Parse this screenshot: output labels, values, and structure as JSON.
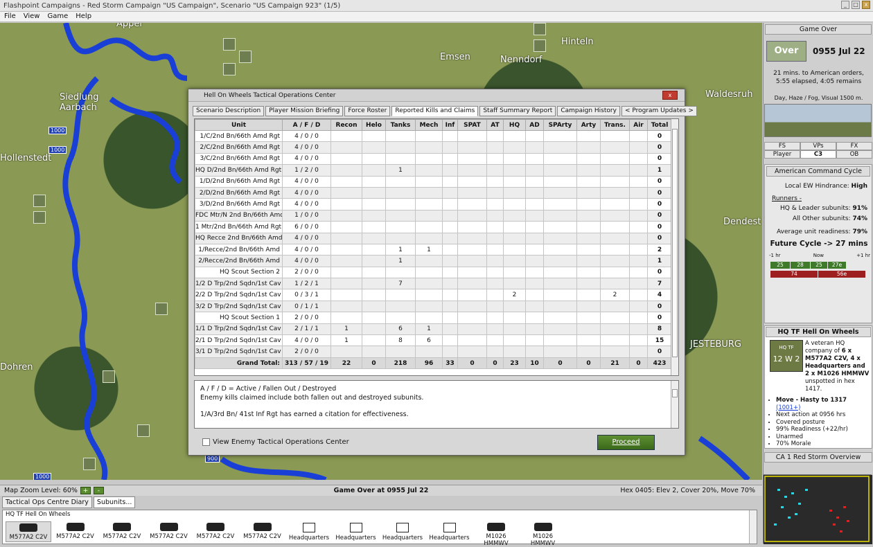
{
  "window": {
    "title": "Flashpoint Campaigns - Red Storm   Campaign \"US Campaign\", Scenario \"US Campaign 923\" (1/5)"
  },
  "menu": [
    "File",
    "View",
    "Game",
    "Help"
  ],
  "map": {
    "towns": [
      "Appel",
      "Emsen",
      "Hinteln",
      "Nenndorf",
      "Siedlung Aarbach",
      "Hollenstedt",
      "Waldesruh",
      "JESTEBURG",
      "Dohren",
      "Dendest"
    ],
    "road_signs": [
      "1000",
      "1000",
      "900",
      "1000"
    ]
  },
  "dialog": {
    "title": "Hell On Wheels Tactical Operations Center",
    "close_label": "x",
    "tabs": [
      "Scenario Description",
      "Player Mission Briefing",
      "Force Roster",
      "Reported Kills and Claims",
      "Staff Summary Report",
      "Campaign History",
      "< Program Updates >"
    ],
    "columns": [
      "Unit",
      "A / F / D",
      "Recon",
      "Helo",
      "Tanks",
      "Mech",
      "Inf",
      "SPAT",
      "AT",
      "HQ",
      "AD",
      "SPArty",
      "Arty",
      "Trans.",
      "Air",
      "Total"
    ],
    "rows": [
      [
        "1/C/2nd Bn/66th Amd Rgt",
        "4 / 0 / 0",
        "",
        "",
        "",
        "",
        "",
        "",
        "",
        "",
        "",
        "",
        "",
        "",
        "",
        "0"
      ],
      [
        "2/C/2nd Bn/66th Amd Rgt",
        "4 / 0 / 0",
        "",
        "",
        "",
        "",
        "",
        "",
        "",
        "",
        "",
        "",
        "",
        "",
        "",
        "0"
      ],
      [
        "3/C/2nd Bn/66th Amd Rgt",
        "4 / 0 / 0",
        "",
        "",
        "",
        "",
        "",
        "",
        "",
        "",
        "",
        "",
        "",
        "",
        "",
        "0"
      ],
      [
        "HQ D/2nd Bn/66th Amd Rgt",
        "1 / 2 / 0",
        "",
        "",
        "1",
        "",
        "",
        "",
        "",
        "",
        "",
        "",
        "",
        "",
        "",
        "1"
      ],
      [
        "1/D/2nd Bn/66th Amd Rgt",
        "4 / 0 / 0",
        "",
        "",
        "",
        "",
        "",
        "",
        "",
        "",
        "",
        "",
        "",
        "",
        "",
        "0"
      ],
      [
        "2/D/2nd Bn/66th Amd Rgt",
        "4 / 0 / 0",
        "",
        "",
        "",
        "",
        "",
        "",
        "",
        "",
        "",
        "",
        "",
        "",
        "",
        "0"
      ],
      [
        "3/D/2nd Bn/66th Amd Rgt",
        "4 / 0 / 0",
        "",
        "",
        "",
        "",
        "",
        "",
        "",
        "",
        "",
        "",
        "",
        "",
        "",
        "0"
      ],
      [
        "FDC Mtr/N 2nd Bn/66th Amd",
        "1 / 0 / 0",
        "",
        "",
        "",
        "",
        "",
        "",
        "",
        "",
        "",
        "",
        "",
        "",
        "",
        "0"
      ],
      [
        "1 Mtr/2nd Bn/66th Amd Rgt",
        "6 / 0 / 0",
        "",
        "",
        "",
        "",
        "",
        "",
        "",
        "",
        "",
        "",
        "",
        "",
        "",
        "0"
      ],
      [
        "HQ Recce 2nd Bn/66th Amd",
        "4 / 0 / 0",
        "",
        "",
        "",
        "",
        "",
        "",
        "",
        "",
        "",
        "",
        "",
        "",
        "",
        "0"
      ],
      [
        "1/Recce/2nd Bn/66th Amd",
        "4 / 0 / 0",
        "",
        "",
        "1",
        "1",
        "",
        "",
        "",
        "",
        "",
        "",
        "",
        "",
        "",
        "2"
      ],
      [
        "2/Recce/2nd Bn/66th Amd",
        "4 / 0 / 0",
        "",
        "",
        "1",
        "",
        "",
        "",
        "",
        "",
        "",
        "",
        "",
        "",
        "",
        "1"
      ],
      [
        "HQ Scout Section 2",
        "2 / 0 / 0",
        "",
        "",
        "",
        "",
        "",
        "",
        "",
        "",
        "",
        "",
        "",
        "",
        "",
        "0"
      ],
      [
        "1/2 D Trp/2nd Sqdn/1st Cav",
        "1 / 2 / 1",
        "",
        "",
        "7",
        "",
        "",
        "",
        "",
        "",
        "",
        "",
        "",
        "",
        "",
        "7"
      ],
      [
        "2/2 D Trp/2nd Sqdn/1st Cav",
        "0 / 3 / 1",
        "",
        "",
        "",
        "",
        "",
        "",
        "",
        "2",
        "",
        "",
        "",
        "2",
        "",
        "4"
      ],
      [
        "3/2 D Trp/2nd Sqdn/1st Cav",
        "0 / 1 / 1",
        "",
        "",
        "",
        "",
        "",
        "",
        "",
        "",
        "",
        "",
        "",
        "",
        "",
        "0"
      ],
      [
        "HQ Scout Section 1",
        "2 / 0 / 0",
        "",
        "",
        "",
        "",
        "",
        "",
        "",
        "",
        "",
        "",
        "",
        "",
        "",
        "0"
      ],
      [
        "1/1 D Trp/2nd Sqdn/1st Cav",
        "2 / 1 / 1",
        "1",
        "",
        "6",
        "1",
        "",
        "",
        "",
        "",
        "",
        "",
        "",
        "",
        "",
        "8"
      ],
      [
        "2/1 D Trp/2nd Sqdn/1st Cav",
        "4 / 0 / 0",
        "1",
        "",
        "8",
        "6",
        "",
        "",
        "",
        "",
        "",
        "",
        "",
        "",
        "",
        "15"
      ],
      [
        "3/1 D Trp/2nd Sqdn/1st Cav",
        "2 / 0 / 0",
        "",
        "",
        "",
        "",
        "",
        "",
        "",
        "",
        "",
        "",
        "",
        "",
        "",
        "0"
      ]
    ],
    "grand_total": [
      "Grand Total:",
      "313 / 57 / 19",
      "22",
      "0",
      "218",
      "96",
      "33",
      "0",
      "0",
      "23",
      "10",
      "0",
      "0",
      "21",
      "0",
      "423"
    ],
    "notes": [
      "A / F / D = Active / Fallen Out / Destroyed",
      "Enemy kills claimed include both fallen out and destroyed subunits.",
      "",
      "1/A/3rd Bn/ 41st Inf Rgt has earned a citation for effectiveness."
    ],
    "checkbox_label": "View Enemy Tactical Operations Center",
    "proceed_label": "Proceed"
  },
  "right_panel": {
    "header": "Game Over",
    "status": "Over",
    "time": "0955 Jul 22",
    "orders_line1": "21 mins. to American orders,",
    "orders_line2": "5:55 elapsed, 4:05 remains",
    "weather": "Day, Haze / Fog, Visual 1500 m.",
    "tabs_row1": [
      "FS",
      "VPs",
      "FX"
    ],
    "tabs_row2": [
      "Player",
      "C3",
      "OB"
    ],
    "cycle_header": "American Command Cycle",
    "ew_label": "Local EW Hindrance:",
    "ew_value": "High",
    "runners_label": "Runners -",
    "hq_label": "HQ & Leader subunits:",
    "hq_value": "91%",
    "other_label": "All Other subunits:",
    "other_value": "74%",
    "readiness_label": "Average unit readiness:",
    "readiness_value": "79%",
    "future_cycle": "Future Cycle -> 27 mins",
    "timeline_labels": [
      "-1 hr",
      "Now",
      "+1 hr"
    ],
    "green_bars": [
      "25",
      "28",
      "25",
      "27e"
    ],
    "red_bars": [
      "74",
      "56e"
    ],
    "unit_header": "HQ TF Hell On Wheels",
    "unit_icon_line1": "HQ TF",
    "unit_icon_line2": "12 W 2",
    "unit_desc_1": "A veteran HQ company of ",
    "unit_desc_2": "6 x M577A2 C2V, 4 x Headquarters and 2 x M1026 HMMWV",
    "unit_desc_3": " unspotted in hex 1417.",
    "unit_bullets": [
      "Move - Hasty to 1317",
      "(1001+)",
      "Next action at 0956 hrs",
      "Covered posture",
      "99% Readiness (+22/hr)",
      "Unarmed",
      "70% Morale"
    ],
    "overview_header": "CA 1 Red Storm Overview"
  },
  "status_bar": {
    "zoom": "Map Zoom Level: 60%",
    "zoom_plus": "+",
    "zoom_minus": "-",
    "center": "Game Over at 0955 Jul 22",
    "hex_info": "Hex 0405: Elev 2, Cover 20%, Move 70%"
  },
  "bottom_tabs": [
    "Tactical Ops Centre Diary",
    "Subunits..."
  ],
  "subunits": {
    "group": "HQ TF Hell On Wheels",
    "items": [
      "M577A2 C2V",
      "M577A2 C2V",
      "M577A2 C2V",
      "M577A2 C2V",
      "M577A2 C2V",
      "M577A2 C2V",
      "Headquarters",
      "Headquarters",
      "Headquarters",
      "Headquarters",
      "M1026 HMMWV",
      "M1026 HMMWV"
    ]
  }
}
